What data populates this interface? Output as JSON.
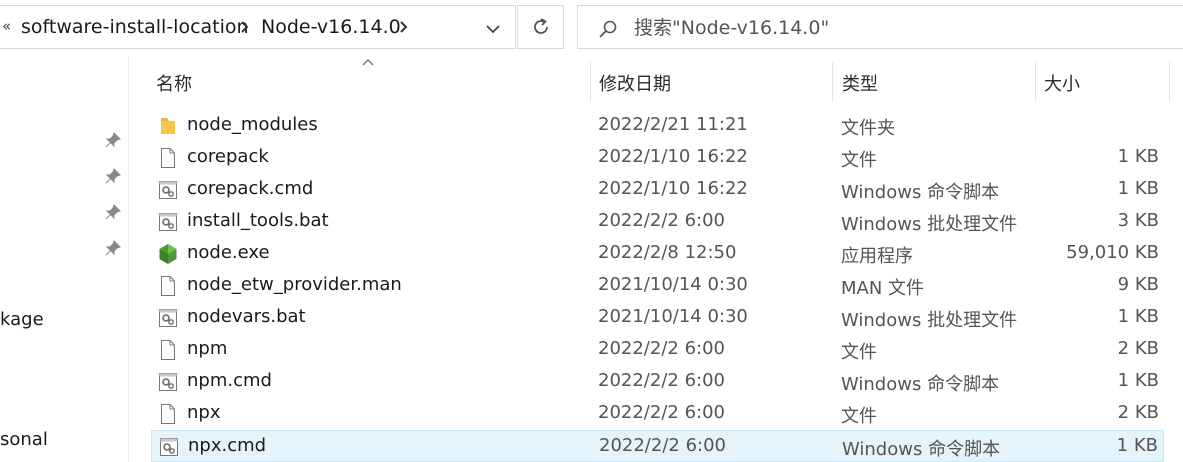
{
  "address_bar": {
    "overflow_glyph": "«",
    "crumbs": [
      "software-install-location",
      "Node-v16.14.0"
    ]
  },
  "search": {
    "placeholder": "搜索\"Node-v16.14.0\""
  },
  "nav_pane": {
    "partial_items": [
      "kage",
      "sonal"
    ]
  },
  "columns": {
    "name": "名称",
    "date": "修改日期",
    "type": "类型",
    "size": "大小"
  },
  "files": [
    {
      "name": "node_modules",
      "date": "2022/2/21 11:21",
      "type": "文件夹",
      "size": "",
      "icon": "folder-icon"
    },
    {
      "name": "corepack",
      "date": "2022/1/10 16:22",
      "type": "文件",
      "size": "1 KB",
      "icon": "file-icon"
    },
    {
      "name": "corepack.cmd",
      "date": "2022/1/10 16:22",
      "type": "Windows 命令脚本",
      "size": "1 KB",
      "icon": "script-gear-icon"
    },
    {
      "name": "install_tools.bat",
      "date": "2022/2/2 6:00",
      "type": "Windows 批处理文件",
      "size": "3 KB",
      "icon": "script-gear-icon"
    },
    {
      "name": "node.exe",
      "date": "2022/2/8 12:50",
      "type": "应用程序",
      "size": "59,010 KB",
      "icon": "nodejs-icon"
    },
    {
      "name": "node_etw_provider.man",
      "date": "2021/10/14 0:30",
      "type": "MAN 文件",
      "size": "9 KB",
      "icon": "file-icon"
    },
    {
      "name": "nodevars.bat",
      "date": "2021/10/14 0:30",
      "type": "Windows 批处理文件",
      "size": "1 KB",
      "icon": "script-gear-icon"
    },
    {
      "name": "npm",
      "date": "2022/2/2 6:00",
      "type": "文件",
      "size": "2 KB",
      "icon": "file-icon"
    },
    {
      "name": "npm.cmd",
      "date": "2022/2/2 6:00",
      "type": "Windows 命令脚本",
      "size": "1 KB",
      "icon": "script-gear-icon"
    },
    {
      "name": "npx",
      "date": "2022/2/2 6:00",
      "type": "文件",
      "size": "2 KB",
      "icon": "file-icon"
    },
    {
      "name": "npx.cmd",
      "date": "2022/2/2 6:00",
      "type": "Windows 命令脚本",
      "size": "1 KB",
      "icon": "script-gear-icon",
      "selected": true
    }
  ],
  "colors": {
    "selection_bg": "#e5f3fb",
    "selection_border": "#cce8f8",
    "folder": "#f8c84a",
    "node_green": "#4e9a3a"
  }
}
